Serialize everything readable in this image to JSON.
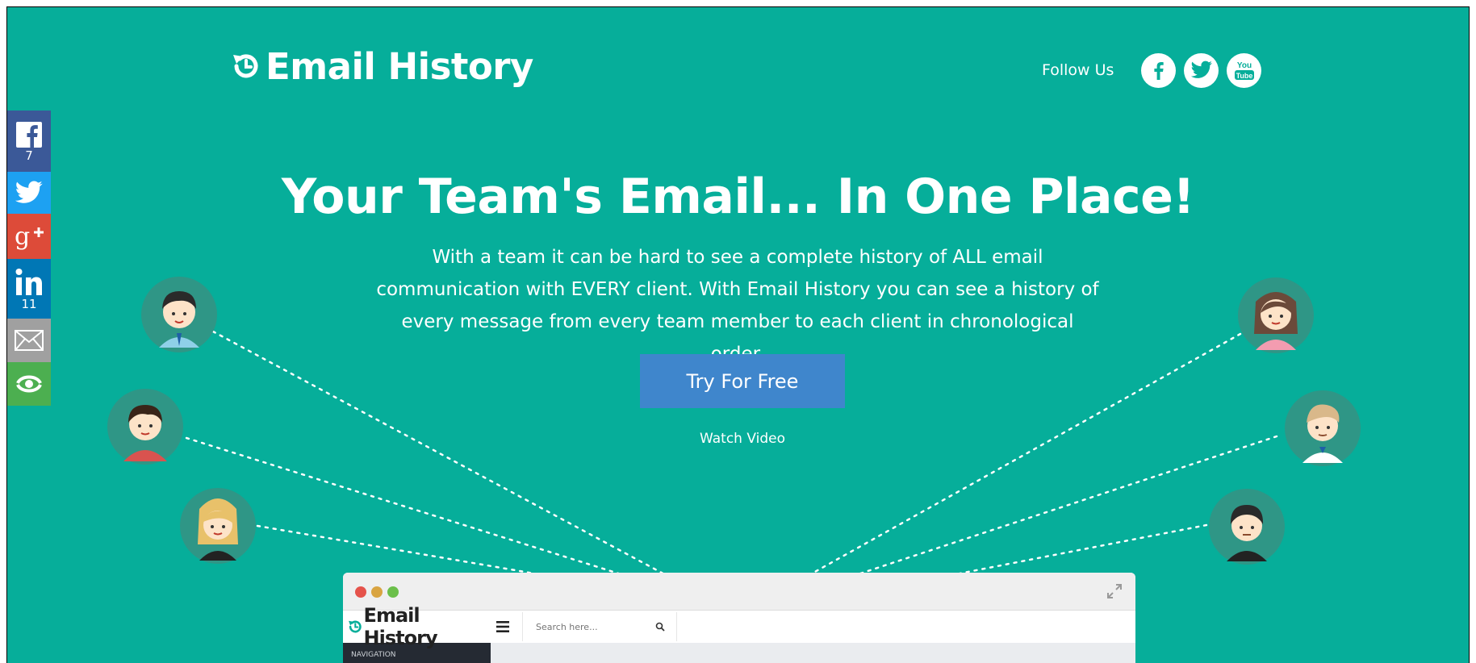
{
  "brand": {
    "name": "Email History",
    "logo_icon": "history-clock-icon"
  },
  "header": {
    "follow_label": "Follow Us",
    "social_links": [
      {
        "name": "facebook",
        "icon": "facebook-icon"
      },
      {
        "name": "twitter",
        "icon": "twitter-icon"
      },
      {
        "name": "youtube",
        "icon": "youtube-icon"
      }
    ]
  },
  "share_bar": {
    "items": [
      {
        "network": "facebook",
        "icon": "facebook-icon",
        "count": "7",
        "color": "#3b5998"
      },
      {
        "network": "twitter",
        "icon": "twitter-icon",
        "count": "",
        "color": "#1da1f2"
      },
      {
        "network": "google-plus",
        "icon": "google-plus-icon",
        "count": "",
        "color": "#dd4b39"
      },
      {
        "network": "linkedin",
        "icon": "linkedin-icon",
        "count": "11",
        "color": "#0077b5"
      },
      {
        "network": "email",
        "icon": "email-icon",
        "count": "",
        "color": "#a0a0a0"
      },
      {
        "network": "more",
        "icon": "share-more-icon",
        "count": "",
        "color": "#4caf50"
      }
    ]
  },
  "hero": {
    "title": "Your Team's Email... In One Place!",
    "description_lines": [
      "With a team it can be hard to see a complete history of ALL email",
      "communication with EVERY client. With Email History you can see a history of",
      "every message from every team member to each client in chronological order."
    ],
    "cta_label": "Try For Free",
    "watch_label": "Watch Video"
  },
  "app_preview": {
    "logo_text": "Email History",
    "search_placeholder": "Search here...",
    "nav_heading": "NAVIGATION"
  },
  "colors": {
    "background": "#06ae9a",
    "cta": "#3f86cc",
    "avatar_ring": "#2f9686"
  }
}
